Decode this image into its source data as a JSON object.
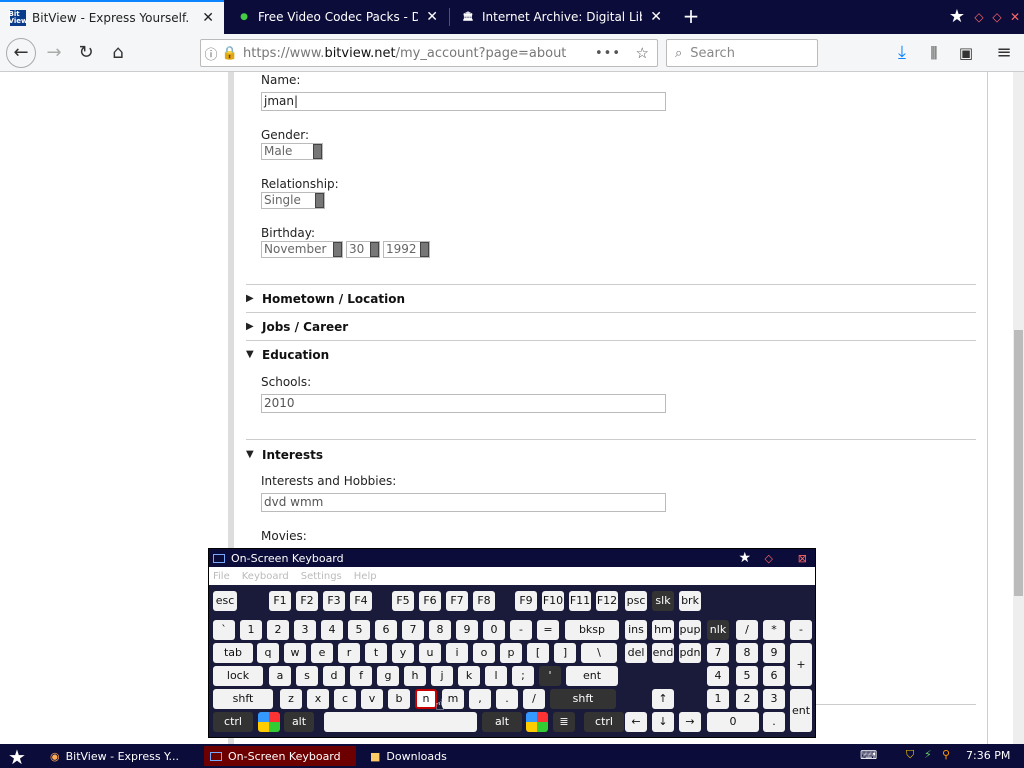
{
  "browser": {
    "tabs": [
      {
        "title": "BitView - Express Yourself.",
        "favicon": "Bit View"
      },
      {
        "title": "Free Video Codec Packs - Downlo",
        "favicon": "globe-icon"
      },
      {
        "title": "Internet Archive: Digital Library of",
        "favicon": "archive-icon"
      }
    ],
    "url_prefix": "https://www.",
    "url_host": "bitview.net",
    "url_path": "/my_account?page=about",
    "search_placeholder": "Search"
  },
  "form": {
    "name_label": "Name:",
    "name_value": "jman",
    "gender_label": "Gender:",
    "gender_value": "Male",
    "relationship_label": "Relationship:",
    "relationship_value": "Single",
    "birthday_label": "Birthday:",
    "birthday_month": "November",
    "birthday_day": "30",
    "birthday_year": "1992",
    "sections": {
      "hometown": "Hometown / Location",
      "jobs": "Jobs / Career",
      "education": "Education",
      "interests": "Interests"
    },
    "schools_label": "Schools:",
    "schools_value": "2010",
    "interests_label": "Interests and Hobbies:",
    "interests_value": "dvd wmm",
    "movies_label": "Movies:"
  },
  "osk": {
    "title": "On-Screen Keyboard",
    "menu": [
      "File",
      "Keyboard",
      "Settings",
      "Help"
    ],
    "row_fn": [
      "esc",
      "F1",
      "F2",
      "F3",
      "F4",
      "F5",
      "F6",
      "F7",
      "F8",
      "F9",
      "F10",
      "F11",
      "F12",
      "psc",
      "slk",
      "brk"
    ],
    "row_num": [
      "`",
      "1",
      "2",
      "3",
      "4",
      "5",
      "6",
      "7",
      "8",
      "9",
      "0",
      "-",
      "=",
      "bksp",
      "ins",
      "hm",
      "pup",
      "nlk",
      "/",
      "*",
      "-"
    ],
    "row_q": [
      "tab",
      "q",
      "w",
      "e",
      "r",
      "t",
      "y",
      "u",
      "i",
      "o",
      "p",
      "[",
      "]",
      "\\",
      "del",
      "end",
      "pdn",
      "7",
      "8",
      "9"
    ],
    "row_a": [
      "lock",
      "a",
      "s",
      "d",
      "f",
      "g",
      "h",
      "j",
      "k",
      "l",
      ";",
      "'",
      "ent",
      "4",
      "5",
      "6"
    ],
    "row_z": [
      "shft",
      "z",
      "x",
      "c",
      "v",
      "b",
      "n",
      "m",
      ",",
      ".",
      "/",
      "shft",
      "↑",
      "1",
      "2",
      "3"
    ],
    "row_ctrl": [
      "ctrl",
      "alt",
      "alt",
      "ctrl",
      "←",
      "↓",
      "→",
      "0",
      "."
    ],
    "numpad_plus": "+",
    "numpad_ent": "ent"
  },
  "taskbar": {
    "items": [
      "BitView - Express Y...",
      "On-Screen Keyboard",
      "Downloads"
    ],
    "time": "7:36 PM"
  }
}
